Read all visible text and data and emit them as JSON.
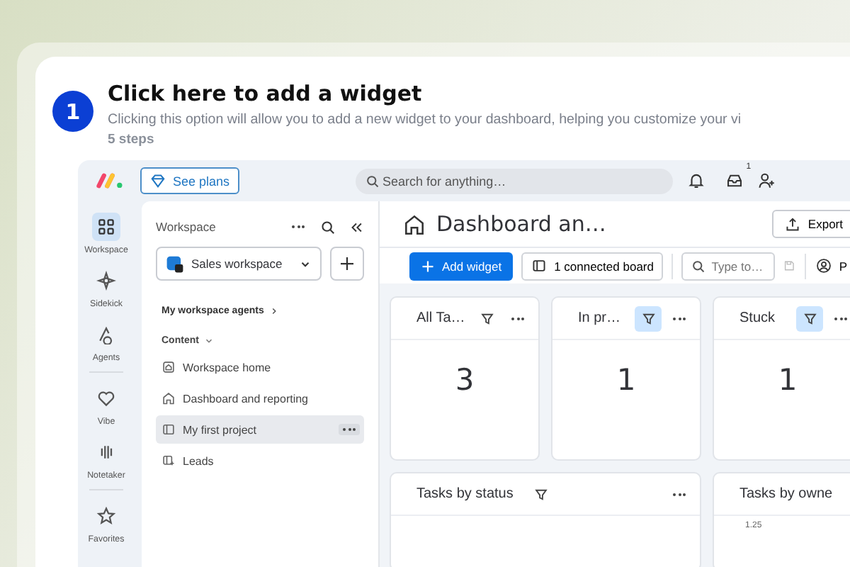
{
  "tour": {
    "step_number": "1",
    "title": "Click here to add a widget",
    "description": "Clicking this option will allow you to add a new widget to your dashboard, helping you customize your vi",
    "step_count": "5 steps"
  },
  "topbar": {
    "plans_button": "See plans",
    "search": {
      "placeholder": "Search for anything…"
    },
    "inbox_badge": "1"
  },
  "rail": [
    {
      "label": "Workspace",
      "selected": true
    },
    {
      "label": "Sidekick",
      "selected": false
    },
    {
      "label": "Agents",
      "selected": false
    },
    {
      "label": "Vibe",
      "selected": false
    },
    {
      "label": "Notetaker",
      "selected": false
    },
    {
      "label": "Favorites",
      "selected": false
    }
  ],
  "sidebar": {
    "title": "Workspace",
    "workspace_select": "Sales workspace",
    "agents_link": "My workspace agents",
    "section": "Content",
    "items": [
      {
        "label": "Workspace home",
        "selected": false
      },
      {
        "label": "Dashboard and reporting",
        "selected": false
      },
      {
        "label": "My first project",
        "selected": true
      },
      {
        "label": "Leads",
        "selected": false
      }
    ]
  },
  "dashboard": {
    "title": "Dashboard an…",
    "export_button": "Export",
    "add_widget_button": "Add widget",
    "connected_boards": "1 connected board",
    "search": {
      "placeholder": "Type to…"
    },
    "person_filter": "P",
    "number_widgets": [
      {
        "title": "All Ta…",
        "value": "3",
        "filter_active": false
      },
      {
        "title": "In pr…",
        "value": "1",
        "filter_active": true
      },
      {
        "title": "Stuck",
        "value": "1",
        "filter_active": true
      }
    ],
    "chart_widgets": [
      {
        "title": "Tasks by status"
      },
      {
        "title": "Tasks by owne",
        "axis_tick": "1.25"
      }
    ]
  }
}
